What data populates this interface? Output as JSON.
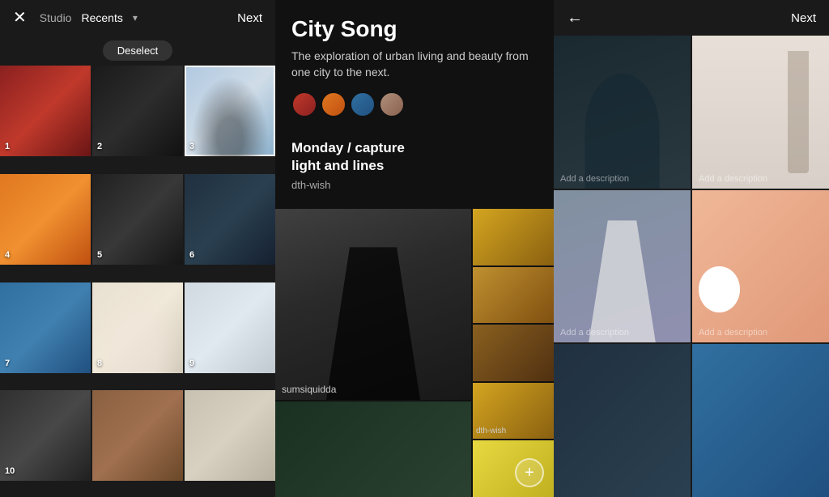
{
  "left": {
    "close_label": "✕",
    "next_label": "Next",
    "studio_label": "Studio",
    "recents_label": "Recents",
    "deselect_label": "Deselect",
    "photos": [
      {
        "number": "1",
        "selected": false
      },
      {
        "number": "2",
        "selected": false
      },
      {
        "number": "3",
        "selected": true
      },
      {
        "number": "4",
        "selected": false
      },
      {
        "number": "5",
        "selected": false
      },
      {
        "number": "6",
        "selected": false
      },
      {
        "number": "7",
        "selected": false
      },
      {
        "number": "8",
        "selected": false
      },
      {
        "number": "9",
        "selected": false
      },
      {
        "number": "10",
        "selected": false
      },
      {
        "number": "",
        "selected": false
      },
      {
        "number": "",
        "selected": false
      }
    ]
  },
  "middle": {
    "title": "City Song",
    "description": "The exploration of urban living and beauty from one city to the next.",
    "post_title": "Monday / capture",
    "post_subtitle": "light and lines",
    "post_author": "dth-wish",
    "main_author": "sumsiquidda",
    "thumb_author": "dth-wish",
    "add_icon": "+"
  },
  "right": {
    "back_label": "←",
    "next_label": "Next",
    "desc1": "Add a description",
    "desc2": "Add a description",
    "desc3": "Add a description",
    "desc4": "Add a description"
  }
}
